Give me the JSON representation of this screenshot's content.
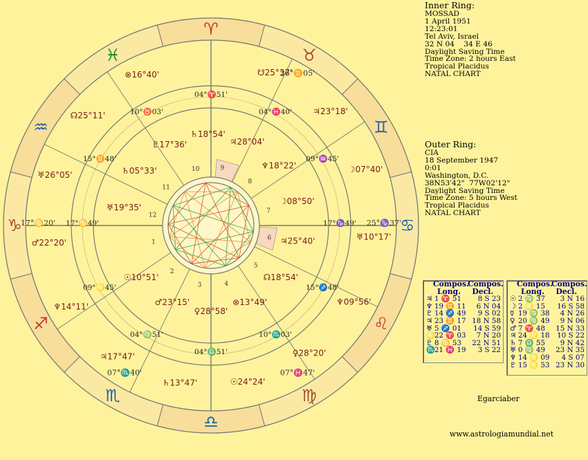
{
  "inner_ring": {
    "heading": "Inner Ring:",
    "lines": [
      "MOSSAD",
      "1 April 1951",
      "12:23:01",
      "Tel Aviv, Israel",
      "32 N 04    34 E 46",
      "Daylight Saving Time",
      "Time Zone: 2 hours East",
      "Tropical Placidus",
      "NATAL CHART"
    ]
  },
  "outer_ring": {
    "heading": "Outer Ring:",
    "lines": [
      "CIA",
      "18 September 1947",
      "0:01",
      "Washington, D.C.",
      "38N53'42\"  77W02'12\"",
      "Daylight Saving Time",
      "Time Zone: 5 hours West",
      "Tropical Placidus",
      "NATAL CHART"
    ]
  },
  "table_left": {
    "headers": [
      "Compos.",
      "Compos."
    ],
    "subheaders": [
      "Long.",
      "Decl."
    ],
    "rows": [
      {
        "glyph": "♃",
        "long": "1 ♈ 51",
        "decl": "8 S 23"
      },
      {
        "glyph": "♆",
        "long": "19 ♊ 11",
        "decl": "6 N 04"
      },
      {
        "glyph": "♇",
        "long": "14 ♐ 49",
        "decl": "9 S 02"
      },
      {
        "glyph": "♃",
        "long": "23 ♊ 17",
        "decl": "18 N 58"
      },
      {
        "glyph": "♅",
        "long": "5 ♐ 01",
        "decl": "14 S 59"
      },
      {
        "glyph": "♌",
        "long": "22 ♈ 03",
        "decl": "7 N 20"
      },
      {
        "glyph": "♇",
        "long": "8 ♋ 53",
        "decl": "22 N 51"
      },
      {
        "glyph": "♏",
        "long": "21 ♓ 19",
        "decl": "3 S 22"
      }
    ]
  },
  "table_right": {
    "headers": [
      "Compos.",
      "Compos."
    ],
    "subheaders": [
      "Long.",
      "Decl."
    ],
    "rows": [
      {
        "glyph": "☉",
        "long": "2 ♍ 37",
        "decl": "3 N 16"
      },
      {
        "glyph": "☽",
        "long": "2 ♌ 15",
        "decl": "16 S 58"
      },
      {
        "glyph": "☿",
        "long": "19 ♍ 38",
        "decl": "4 N 26"
      },
      {
        "glyph": "♀",
        "long": "20 ♍ 49",
        "decl": "9 N 06"
      },
      {
        "glyph": "♂",
        "long": "7 ♈ 48",
        "decl": "15 N 33"
      },
      {
        "glyph": "♃",
        "long": "24 ♌ 18",
        "decl": "10 S 22"
      },
      {
        "glyph": "♄",
        "long": "7 ♎ 55",
        "decl": "9 N 42"
      },
      {
        "glyph": "♅",
        "long": "0 ♍ 49",
        "decl": "23 N 35"
      },
      {
        "glyph": "♆",
        "long": "14 ♌ 09",
        "decl": "4 S 07"
      },
      {
        "glyph": "♇",
        "long": "15 ♌ 53",
        "decl": "23 N 30"
      }
    ]
  },
  "author": "Egarciaber",
  "website": "www.astrologiamundial.net",
  "signs": [
    {
      "glyph": "♈",
      "color": "#C0392B"
    },
    {
      "glyph": "♓",
      "color": "#1E8A1E"
    },
    {
      "glyph": "♒",
      "color": "#1E5FA8"
    },
    {
      "glyph": "♑",
      "color": "#A0522D"
    },
    {
      "glyph": "♐",
      "color": "#C0392B"
    },
    {
      "glyph": "♏",
      "color": "#1E5FA8"
    },
    {
      "glyph": "♎",
      "color": "#1E5FA8"
    },
    {
      "glyph": "♍",
      "color": "#A0522D"
    },
    {
      "glyph": "♌",
      "color": "#C0392B"
    },
    {
      "glyph": "♋",
      "color": "#1E5FA8"
    },
    {
      "glyph": "♊",
      "color": "#1E5FA8"
    },
    {
      "glyph": "♉",
      "color": "#A0522D"
    }
  ],
  "house_numbers": [
    "1",
    "2",
    "3",
    "4",
    "5",
    "6",
    "7",
    "8",
    "9",
    "10",
    "11",
    "12"
  ],
  "cusps": [
    {
      "deg": "17°",
      "sign": "♋",
      "min": "49'"
    },
    {
      "deg": "09°",
      "sign": "♌",
      "min": "45'"
    },
    {
      "deg": "04°",
      "sign": "♍",
      "min": "51'"
    },
    {
      "deg": "04°",
      "sign": "♎",
      "min": "51'"
    },
    {
      "deg": "10°",
      "sign": "♏",
      "min": "03'"
    },
    {
      "deg": "15°",
      "sign": "♐",
      "min": "48'"
    },
    {
      "deg": "17°",
      "sign": "♑",
      "min": "49'"
    },
    {
      "deg": "09°",
      "sign": "♒",
      "min": "45'"
    },
    {
      "deg": "04°",
      "sign": "♓",
      "min": "40'"
    },
    {
      "deg": "04°",
      "sign": "♈",
      "min": "51'"
    },
    {
      "deg": "10°",
      "sign": "♉",
      "min": "03'"
    },
    {
      "deg": "15°",
      "sign": "♊",
      "min": "48'"
    }
  ],
  "outer_cusps": [
    {
      "deg": "17°",
      "sign": "♋",
      "min": "20'"
    },
    {
      "deg": "07°",
      "sign": "♏",
      "min": "40'"
    },
    {
      "deg": "07°",
      "sign": "♓",
      "min": "47'"
    },
    {
      "deg": "25°",
      "sign": "♑",
      "min": "37'"
    },
    {
      "deg": "26°",
      "sign": "♊",
      "min": "05'"
    }
  ],
  "inner_planets": [
    {
      "glyph": "♅",
      "deg": "19°",
      "min": "35'"
    },
    {
      "glyph": "♄",
      "deg": "05°",
      "min": "33'"
    },
    {
      "glyph": "♇",
      "deg": "17°",
      "min": "36'"
    },
    {
      "glyph": "♄",
      "deg": "18°",
      "min": "54'"
    },
    {
      "glyph": "♃",
      "deg": "28°",
      "min": "04'"
    },
    {
      "glyph": "♆",
      "deg": "18°",
      "min": "22'"
    },
    {
      "glyph": "☽",
      "deg": "08°",
      "min": "50'"
    },
    {
      "glyph": "♃",
      "deg": "25°",
      "min": "40'"
    },
    {
      "glyph": "☊",
      "deg": "18°",
      "min": "54'"
    },
    {
      "glyph": "⊗",
      "deg": "13°",
      "min": "49'"
    },
    {
      "glyph": "♀",
      "deg": "28°",
      "min": "58'"
    },
    {
      "glyph": "♂",
      "deg": "23°",
      "min": "15'"
    },
    {
      "glyph": "☉",
      "deg": "10°",
      "min": "51'"
    }
  ],
  "outer_planets": [
    {
      "glyph": "⊗",
      "deg": "16°",
      "min": "40'"
    },
    {
      "glyph": "☊",
      "deg": "25°",
      "min": "11'"
    },
    {
      "glyph": "♅",
      "deg": "26°",
      "min": "05'"
    },
    {
      "glyph": "♂",
      "deg": "22°",
      "min": "20'"
    },
    {
      "glyph": "♆",
      "deg": "14°",
      "min": "11'"
    },
    {
      "glyph": "♃",
      "deg": "17°",
      "min": "47'"
    },
    {
      "glyph": "♄",
      "deg": "13°",
      "min": "47'"
    },
    {
      "glyph": "☉",
      "deg": "24°",
      "min": "24'"
    },
    {
      "glyph": "♀",
      "deg": "28°",
      "min": "20'"
    },
    {
      "glyph": "♆",
      "deg": "09°",
      "min": "56'"
    },
    {
      "glyph": "♅",
      "deg": "10°",
      "min": "17'"
    },
    {
      "glyph": "☽",
      "deg": "07°",
      "min": "40'"
    },
    {
      "glyph": "♃",
      "deg": "23°",
      "min": "18'"
    },
    {
      "glyph": "☋",
      "deg": "25°",
      "min": "37'"
    }
  ],
  "colors": {
    "background": "#FEF39C",
    "sign_band": "#F8DE9A",
    "ring_line": "#777777",
    "aspect_red": "#D9442A",
    "aspect_green": "#2E9E2E",
    "aspect_orange": "#E38B2E"
  }
}
